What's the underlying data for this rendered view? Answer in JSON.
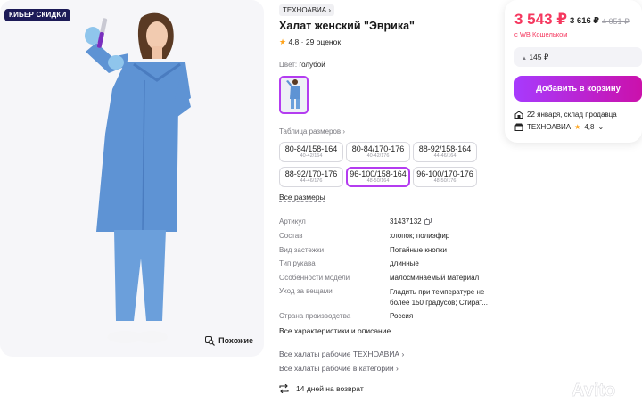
{
  "promo_badge": "КИБЕР СКИДКИ",
  "similar_label": "Похожие",
  "brand_chip": "ТЕХНОАВИА",
  "title": "Халат женский \"Эврика\"",
  "rating": {
    "score": "4,8",
    "separator": "·",
    "reviews": "29 оценок"
  },
  "color": {
    "label": "Цвет:",
    "value": "голубой"
  },
  "size_table_link": "Таблица размеров",
  "sizes": [
    {
      "main": "80-84/158-164",
      "sub": "40-42/164"
    },
    {
      "main": "80-84/170-176",
      "sub": "40-42/176"
    },
    {
      "main": "88-92/158-164",
      "sub": "44-46/164"
    },
    {
      "main": "88-92/170-176",
      "sub": "44-46/176"
    },
    {
      "main": "96-100/158-164",
      "sub": "48-50/164"
    },
    {
      "main": "96-100/170-176",
      "sub": "48-50/176"
    }
  ],
  "selected_size_index": 4,
  "all_sizes": "Все размеры",
  "specs": [
    {
      "key": "Артикул",
      "value": "31437132"
    },
    {
      "key": "Состав",
      "value": "хлопок; полиэфир"
    },
    {
      "key": "Вид застежки",
      "value": "Потайные кнопки"
    },
    {
      "key": "Тип рукава",
      "value": "длинные"
    },
    {
      "key": "Особенности модели",
      "value": "малосминаемый материал"
    },
    {
      "key": "Уход за вещами",
      "value": "Гладить при температуре не более 150 градусов; Стират..."
    },
    {
      "key": "Страна производства",
      "value": "Россия"
    }
  ],
  "all_specs_link": "Все характеристики и описание",
  "brand_link": "Все халаты рабочие ТЕХНОАВИА",
  "category_link": "Все халаты рабочие в категории",
  "returns": "14 дней на возврат",
  "buy": {
    "price": "3 543 ₽",
    "old_price": "3 616 ₽",
    "crossed_price": "4 051 ₽",
    "wallet_note": "с WB Кошельком",
    "installment": "145 ₽",
    "add_to_cart": "Добавить в корзину",
    "delivery": "22 января, склад продавца",
    "seller_name": "ТЕХНОАВИА",
    "seller_rating": "4,8"
  },
  "colors": {
    "accent": "#b43cf0",
    "price": "#f5385f",
    "badge": "#1c1a57",
    "coat": "#5e93d4"
  },
  "watermark": "Avito"
}
